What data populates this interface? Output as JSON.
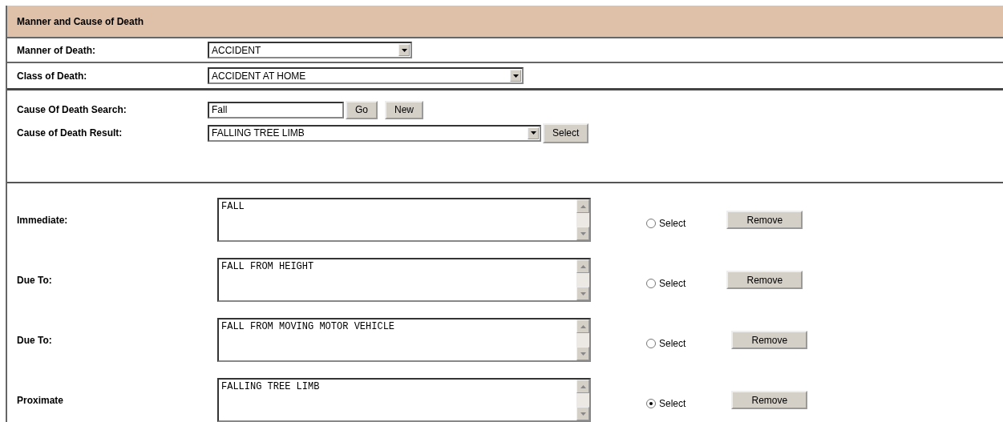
{
  "section_title": "Manner and Cause of Death",
  "manner": {
    "label": "Manner of Death:",
    "value": "ACCIDENT"
  },
  "class": {
    "label": "Class of Death:",
    "value": "ACCIDENT AT HOME"
  },
  "search": {
    "label": "Cause Of Death Search:",
    "value": "Fall",
    "go_button": "Go",
    "new_button": "New"
  },
  "result": {
    "label": "Cause of Death Result:",
    "value": "FALLING TREE LIMB",
    "select_button": "Select"
  },
  "causes": [
    {
      "label": "Immediate:",
      "text": "FALL",
      "radio_label": "Select",
      "selected": false,
      "remove_button": "Remove"
    },
    {
      "label": "Due To:",
      "text": "FALL FROM HEIGHT",
      "radio_label": "Select",
      "selected": false,
      "remove_button": "Remove"
    },
    {
      "label": "Due To:",
      "text": "FALL FROM MOVING MOTOR VEHICLE",
      "radio_label": "Select",
      "selected": false,
      "remove_button": "Remove"
    },
    {
      "label": "Proximate",
      "text": "FALLING TREE LIMB",
      "radio_label": "Select",
      "selected": true,
      "remove_button": "Remove"
    }
  ]
}
